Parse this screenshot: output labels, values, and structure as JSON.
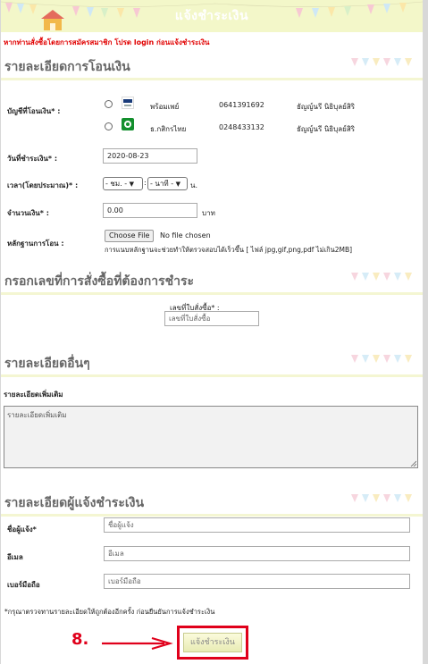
{
  "header": {
    "title": "แจ้งชำระเงิน"
  },
  "warning": "หากท่านสั่งซื้อโดยการสมัครสมาชิก โปรด login ก่อนแจ้งชำระเงิน",
  "sections": {
    "transfer": "รายละเอียดการโอนเงิน",
    "order": "กรอกเลขที่การสั่งซื้อที่ต้องการชำระ",
    "other": "รายละเอียดอื่นๆ",
    "payer": "รายละเอียดผู้แจ้งชำระเงิน"
  },
  "transfer": {
    "account_label": "บัญชีที่โอนเงิน* :",
    "accounts": [
      {
        "bank": "พร้อมเพย์",
        "number": "0641391692",
        "name": "ธัญญ์นรี นิธิบุลย์สิริ",
        "logo_text": "PromptPay"
      },
      {
        "bank": "ธ.กสิกรไทย",
        "number": "0248433132",
        "name": "ธัญญ์นรี นิธิบุลย์สิริ",
        "logo_color": "#138f2d"
      }
    ],
    "date_label": "วันที่ชำระเงิน* :",
    "date_value": "2020-08-23",
    "time_label": "เวลา(โดยประมาณ)* :",
    "hour_value": "- ชม. -",
    "minute_value": "- นาที -",
    "time_unit": "น.",
    "amount_label": "จำนวนเงิน* :",
    "amount_value": "0.00",
    "amount_unit": "บาท",
    "proof_label": "หลักฐานการโอน :",
    "file_button": "Choose File",
    "file_status": "No file chosen",
    "proof_hint": "การแนบหลักฐานจะช่วยทำให้ตรวจสอบได้เร็วขึ้น [ ไฟล์ jpg,gif,png,pdf ไม่เกิน2MB]"
  },
  "order": {
    "label": "เลขที่ใบสั่งซื้อ* :",
    "placeholder": "เลขที่ใบสั่งซื้อ"
  },
  "other": {
    "label": "รายละเอียดเพิ่มเติม",
    "placeholder": "รายละเอียดเพิ่มเติม"
  },
  "payer": {
    "name_label": "ชื่อผู้แจ้ง*",
    "name_placeholder": "ชื่อผู้แจ้ง",
    "email_label": "อีเมล",
    "email_placeholder": "อีเมล",
    "phone_label": "เบอร์มือถือ",
    "phone_placeholder": "เบอร์มือถือ"
  },
  "note": "*กรุณาตรวจทานรายละเอียดให้ถูกต้องอีกครั้ง ก่อนยืนยันการแจ้งชำระเงิน",
  "submit_label": "แจ้งชำระเงิน",
  "step_marker": "8.",
  "colors": {
    "header_bg": "#f3f7c9",
    "warning": "#e10000",
    "annotation": "#e0001b"
  }
}
